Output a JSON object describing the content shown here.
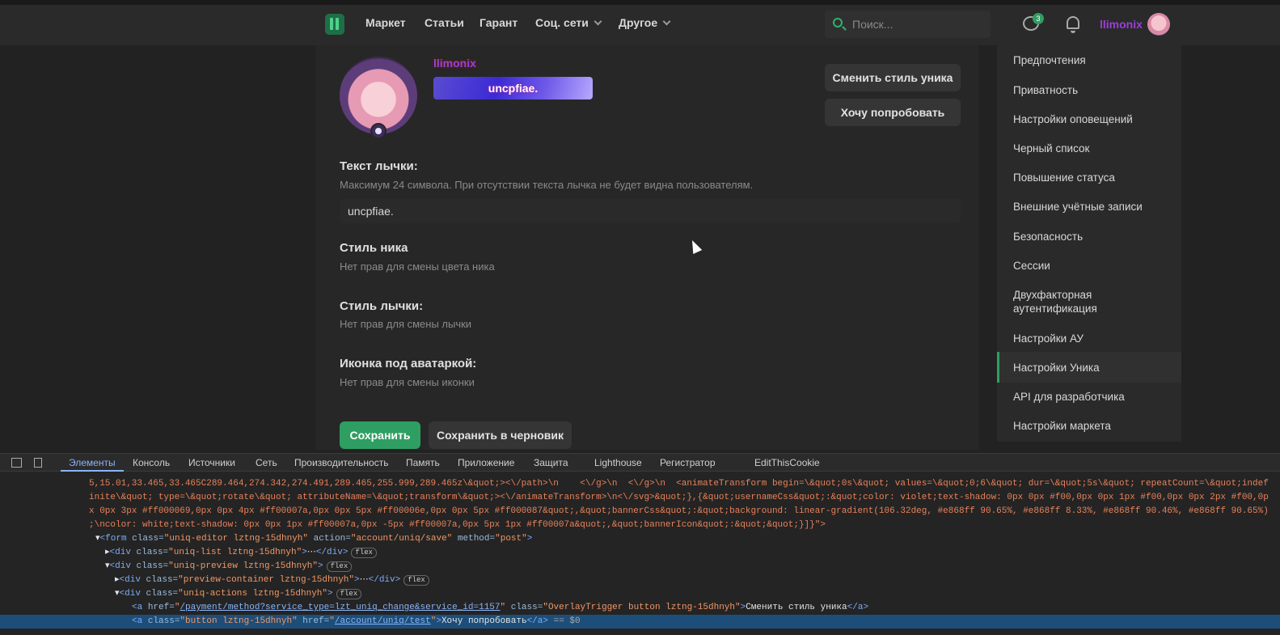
{
  "nav": {
    "items": [
      "Маркет",
      "Статьи",
      "Гарант",
      "Соц. сети",
      "Другое"
    ],
    "search_placeholder": "Поиск...",
    "chat_badge": "3",
    "username": "llimonix"
  },
  "profile": {
    "name": "llimonix",
    "banner_text": "uncpfiae.",
    "btn_change_style": "Сменить стиль уника",
    "btn_try": "Хочу попробовать"
  },
  "form": {
    "badge_text_label": "Текст лычки:",
    "badge_text_hint": "Максимум 24 символа. При отсутствии текста лычка не будет видна пользователям.",
    "badge_text_value": "uncpfiae.",
    "nick_style_label": "Стиль ника",
    "nick_style_hint": "Нет прав для смены цвета ника",
    "badge_style_label": "Стиль лычки:",
    "badge_style_hint": "Нет прав для смены лычки",
    "avatar_icon_label": "Иконка под аватаркой:",
    "avatar_icon_hint": "Нет прав для смены иконки",
    "save": "Сохранить",
    "save_draft": "Сохранить в черновик"
  },
  "sidebar": {
    "items": [
      "Предпочтения",
      "Приватность",
      "Настройки оповещений",
      "Черный список",
      "Повышение статуса",
      "Внешние учётные записи",
      "Безопасность",
      "Сессии",
      "Двухфакторная аутентификация",
      "Настройки АУ",
      "Настройки Уника",
      "API для разработчика",
      "Настройки маркета"
    ],
    "active": "Настройки Уника"
  },
  "devtools": {
    "tabs": [
      "Элементы",
      "Консоль",
      "Источники",
      "Сеть",
      "Производительность",
      "Память",
      "Приложение",
      "Защита",
      "Lighthouse",
      "Регистратор",
      "EditThisCookie"
    ],
    "active_tab": "Элементы",
    "lines": [
      "5,15.01,33.465,33.465C289.464,274.342,274.491,289.465,255.999,289.465z\\&quot;><\\/path>\\n    <\\/g>\\n  <\\/g>\\n  <animateTransform begin=\\&quot;0s\\&quot; values=\\&quot;0;6\\&quot; dur=\\&quot;5s\\&quot; repeatCount=\\&quot;indef",
      "inite\\&quot; type=\\&quot;rotate\\&quot; attributeName=\\&quot;transform\\&quot;><\\/animateTransform>\\n<\\/svg>&quot;},{&quot;usernameCss&quot;:&quot;color: violet;text-shadow: 0px 0px #f00,0px 0px 1px #f00,0px 0px 2px #f00,0p",
      "x 0px 3px #ff000069,0px 0px 4px #ff00007a,0px 0px 5px #ff00006e,0px 0px 5px #ff000087&quot;,&quot;bannerCss&quot;:&quot;background: linear-gradient(106.32deg, #e868ff 90.65%, #e868ff 8.33%, #e868ff 90.46%, #e868ff 90.65%)",
      ";\\ncolor: white;text-shadow: 0px 0px 1px #ff00007a,0px -5px #ff00007a,0px 5px 1px #ff00007a&quot;,&quot;bannerIcon&quot;:&quot;&quot;}]}\">"
    ],
    "form_tag": "form",
    "form_class": "uniq-editor lztng-15dhnyh",
    "form_action": "account/uniq/save",
    "form_method": "post",
    "div_list_class": "uniq-list lztng-15dhnyh",
    "div_preview_class": "uniq-preview lztng-15dhnyh",
    "div_preview_container_class": "preview-container lztng-15dhnyh",
    "div_actions_class": "uniq-actions lztng-15dhnyh",
    "a1_href": "/payment/method?service_type=lzt_uniq_change&service_id=1157",
    "a1_class": "OverlayTrigger button lztng-15dhnyh",
    "a1_text": "Сменить стиль уника",
    "a2_class": "button lztng-15dhnyh",
    "a2_href": "/account/uniq/test",
    "a2_text": "Хочу попробовать",
    "a2_suffix": "== $0",
    "flex": "flex"
  }
}
